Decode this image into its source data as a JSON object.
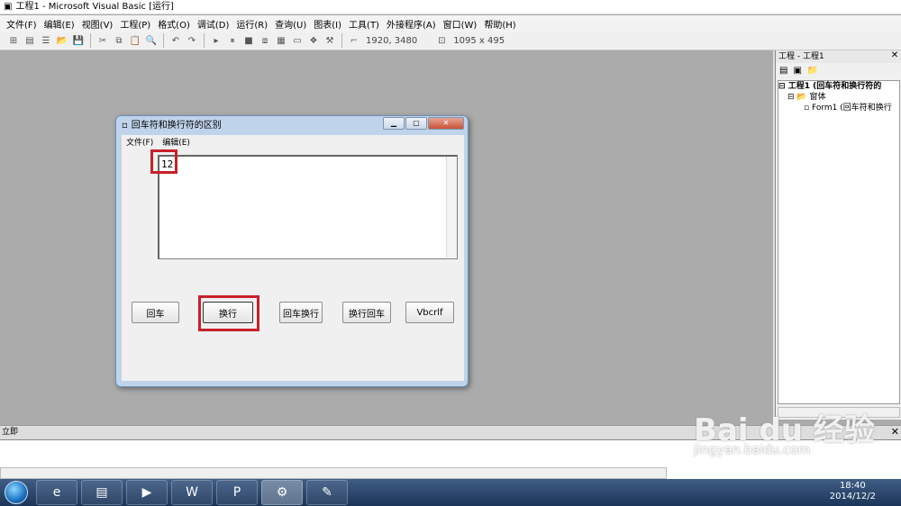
{
  "window": {
    "title": "工程1 - Microsoft Visual Basic [运行]"
  },
  "menu": [
    "文件(F)",
    "编辑(E)",
    "视图(V)",
    "工程(P)",
    "格式(O)",
    "调试(D)",
    "运行(R)",
    "查询(U)",
    "图表(I)",
    "工具(T)",
    "外接程序(A)",
    "窗口(W)",
    "帮助(H)"
  ],
  "toolbar": {
    "position": "1920, 3480",
    "size": "1095 x 495"
  },
  "project": {
    "title": "工程 - 工程1",
    "tree": [
      "工程1 (回车符和换行符的",
      "窗体",
      "Form1 (回车符和换行"
    ]
  },
  "immediate": {
    "title": "立即"
  },
  "form": {
    "title": "回车符和换行符的区别",
    "menu": [
      "文件(F)",
      "编辑(E)"
    ],
    "textbox_value": "12",
    "buttons": [
      "回车",
      "换行",
      "回车换行",
      "换行回车",
      "Vbcrlf"
    ]
  },
  "taskbar": {
    "time": "18:40",
    "date": "2014/12/2"
  },
  "watermark": {
    "brand": "Bai du 经验",
    "url": "jingyan.baidu.com"
  }
}
